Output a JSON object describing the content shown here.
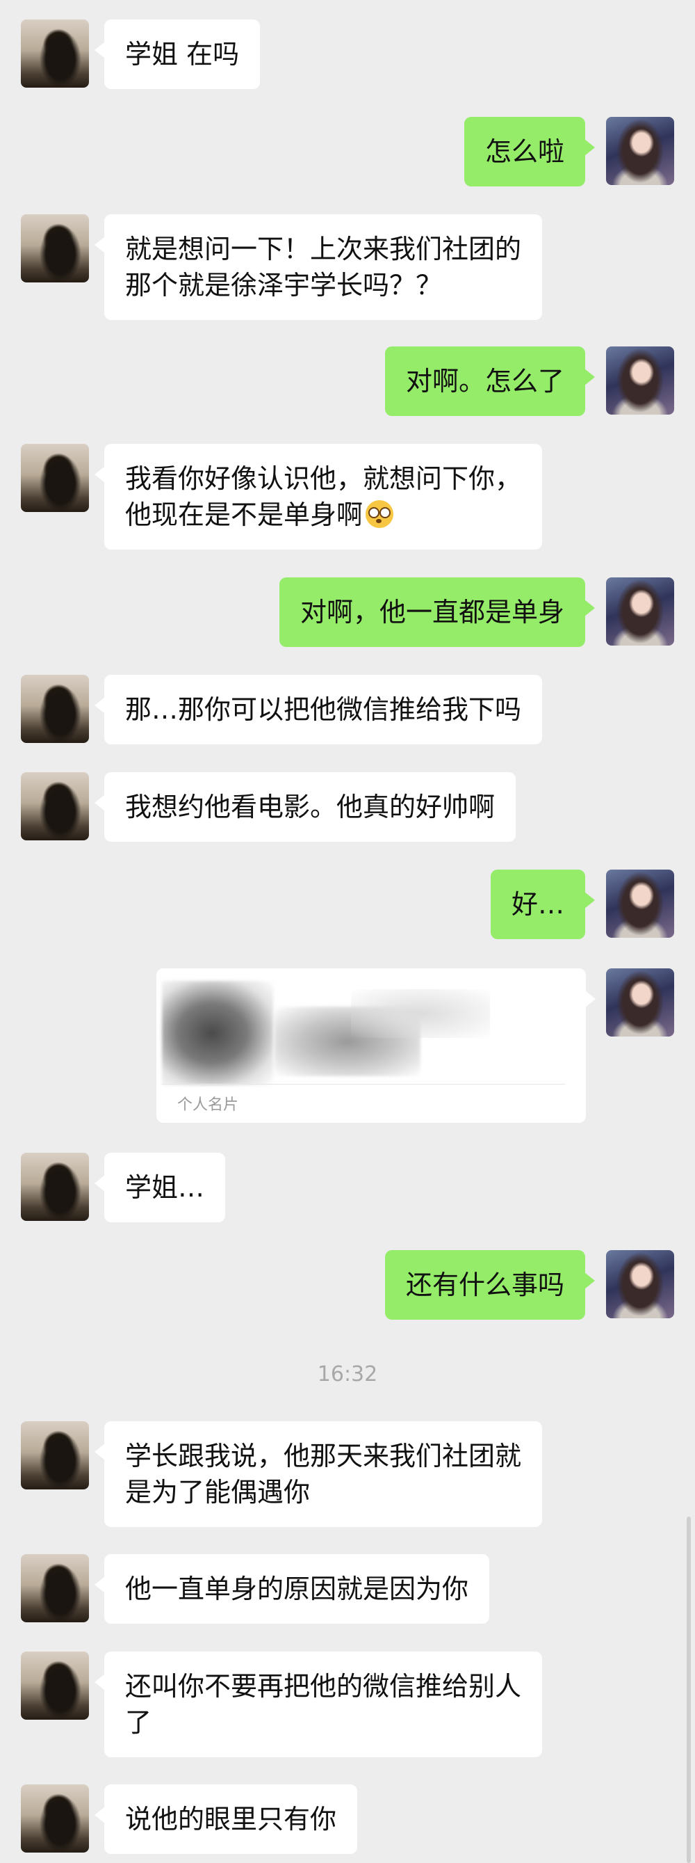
{
  "messages": [
    {
      "side": "other",
      "lines": [
        "学姐 在吗"
      ]
    },
    {
      "side": "self",
      "lines": [
        "怎么啦"
      ]
    },
    {
      "side": "other",
      "lines": [
        "就是想问一下！上次来我们社团的",
        "那个就是徐泽宇学长吗？？"
      ]
    },
    {
      "side": "self",
      "lines": [
        "对啊。怎么了"
      ]
    },
    {
      "side": "other",
      "lines": [
        "我看你好像认识他，就想问下你，",
        "他现在是不是单身啊"
      ],
      "emoji": "flushed-face"
    },
    {
      "side": "self",
      "lines": [
        "对啊，他一直都是单身"
      ]
    },
    {
      "side": "other",
      "lines": [
        "那…那你可以把他微信推给我下吗"
      ]
    },
    {
      "side": "other",
      "lines": [
        "我想约他看电影。他真的好帅啊"
      ]
    },
    {
      "side": "self",
      "lines": [
        "好…"
      ]
    },
    {
      "side": "other",
      "lines": [
        "学姐…"
      ]
    },
    {
      "side": "self",
      "lines": [
        "还有什么事吗"
      ]
    },
    {
      "side": "other",
      "lines": [
        "学长跟我说，他那天来我们社团就",
        "是为了能偶遇你"
      ]
    },
    {
      "side": "other",
      "lines": [
        "他一直单身的原因就是因为你"
      ]
    },
    {
      "side": "other",
      "lines": [
        "还叫你不要再把他的微信推给别人",
        "了"
      ]
    },
    {
      "side": "other",
      "lines": [
        "说他的眼里只有你"
      ]
    }
  ],
  "contact_card": {
    "label": "个人名片"
  },
  "timestamp": "16:32"
}
